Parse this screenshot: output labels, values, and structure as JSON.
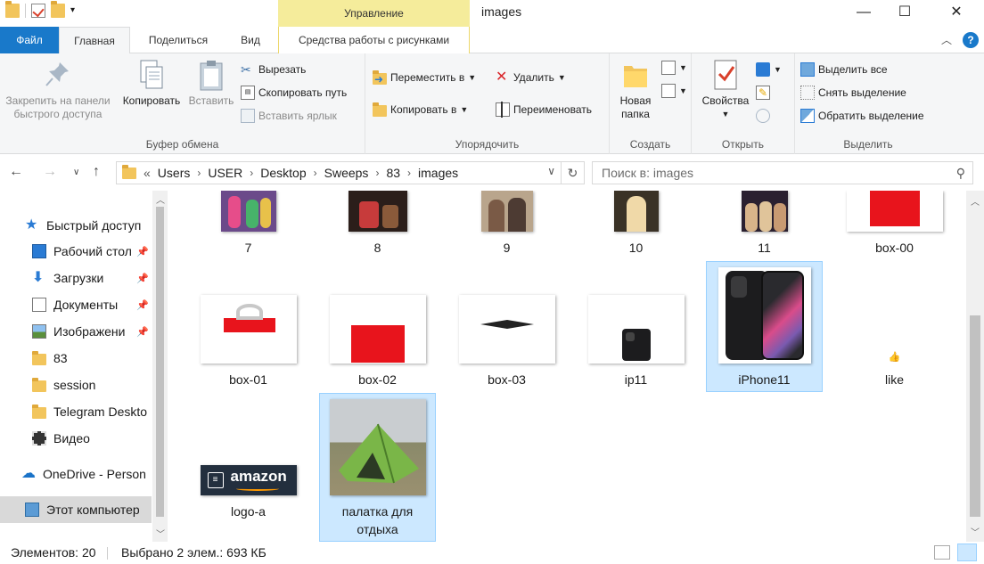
{
  "titlebar": {
    "tools_header": "Управление",
    "window_title": "images",
    "minimize": "—",
    "maximize": "☐",
    "close": "✕"
  },
  "tabs": {
    "file": "Файл",
    "home": "Главная",
    "share": "Поделиться",
    "view": "Вид",
    "picture_tools": "Средства работы с рисунками"
  },
  "ribbon": {
    "clipboard": {
      "label": "Буфер обмена",
      "pin": "Закрепить на панели быстрого доступа",
      "copy": "Копировать",
      "paste": "Вставить",
      "cut": "Вырезать",
      "copy_path": "Скопировать путь",
      "paste_shortcut": "Вставить ярлык"
    },
    "organize": {
      "label": "Упорядочить",
      "move_to": "Переместить в",
      "copy_to": "Копировать в",
      "delete": "Удалить",
      "rename": "Переименовать"
    },
    "create": {
      "label": "Создать",
      "new_folder": "Новая папка"
    },
    "open": {
      "label": "Открыть",
      "properties": "Свойства"
    },
    "select": {
      "label": "Выделить",
      "select_all": "Выделить все",
      "select_none": "Снять выделение",
      "invert": "Обратить выделение"
    }
  },
  "address": {
    "prefix": "«",
    "segments": [
      "Users",
      "USER",
      "Desktop",
      "Sweeps",
      "83",
      "images"
    ],
    "search_placeholder": "Поиск в: images"
  },
  "sidebar": {
    "items": [
      {
        "label": "Быстрый доступ",
        "icon": "star-icon"
      },
      {
        "label": "Рабочий стол",
        "icon": "desktop-icon",
        "pinned": true
      },
      {
        "label": "Загрузки",
        "icon": "download-icon",
        "pinned": true
      },
      {
        "label": "Документы",
        "icon": "document-icon",
        "pinned": true
      },
      {
        "label": "Изображени",
        "icon": "pictures-icon",
        "pinned": true
      },
      {
        "label": "83",
        "icon": "folder-icon"
      },
      {
        "label": "session",
        "icon": "folder-icon"
      },
      {
        "label": "Telegram Deskto",
        "icon": "folder-icon"
      },
      {
        "label": "Видео",
        "icon": "video-icon"
      },
      {
        "label": "OneDrive - Person",
        "icon": "cloud-icon"
      },
      {
        "label": "Этот компьютер",
        "icon": "computer-icon"
      }
    ]
  },
  "files": [
    {
      "name": "7"
    },
    {
      "name": "8"
    },
    {
      "name": "9"
    },
    {
      "name": "10"
    },
    {
      "name": "11"
    },
    {
      "name": "box-00"
    },
    {
      "name": "box-01"
    },
    {
      "name": "box-02"
    },
    {
      "name": "box-03"
    },
    {
      "name": "ip11"
    },
    {
      "name": "iPhone11",
      "selected": true
    },
    {
      "name": "like"
    },
    {
      "name": "logo-a"
    },
    {
      "name": "палатка для отдыха",
      "selected": true
    }
  ],
  "logo_text": "amazon",
  "status": {
    "count": "Элементов: 20",
    "selection": "Выбрано 2 элем.: 693 КБ"
  }
}
